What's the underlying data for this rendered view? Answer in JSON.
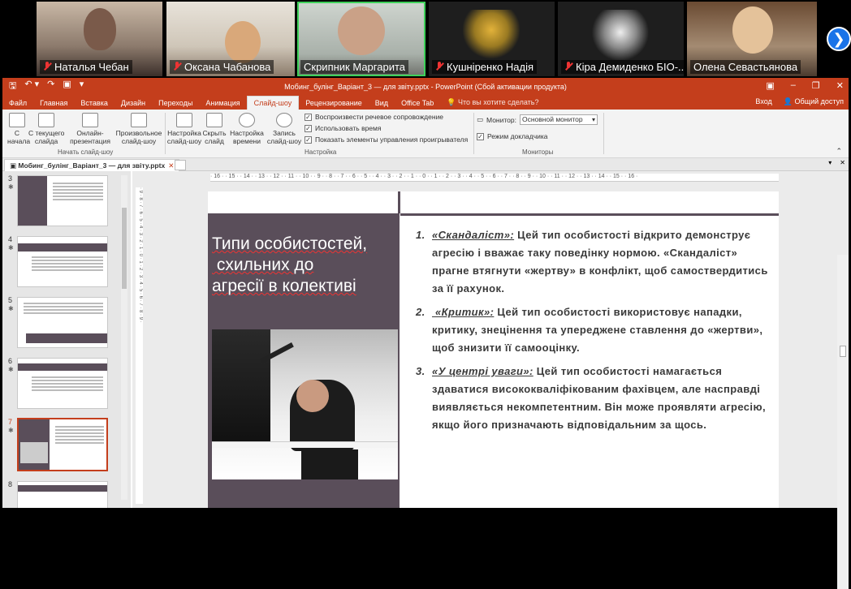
{
  "participants": [
    {
      "name": "Наталья Чебан",
      "muted": true
    },
    {
      "name": "Оксана Чабанова",
      "muted": true
    },
    {
      "name": "Скрипник Маргарита",
      "muted": false,
      "active": true
    },
    {
      "name": "Кушніренко Надія",
      "muted": true
    },
    {
      "name": "Кіра Демиденко БІО-...",
      "muted": true
    },
    {
      "name": "Олена Севастьянова",
      "muted": false
    }
  ],
  "window": {
    "title": "Мобинг_булінг_Варіант_3 — для звіту.pptx - PowerPoint (Сбой активации продукта)"
  },
  "tabs": [
    "Файл",
    "Главная",
    "Вставка",
    "Дизайн",
    "Переходы",
    "Анимация",
    "Слайд-шоу",
    "Рецензирование",
    "Вид",
    "Office Tab"
  ],
  "selected_tab": "Слайд-шоу",
  "tell_me": "Что вы хотите сделать?",
  "signin": "Вход",
  "share": "Общий доступ",
  "ribbon": {
    "from_start": "С\nначала",
    "from_current": "С текущего\nслайда",
    "online": "Онлайн-\nпрезентация",
    "custom": "Произвольное\nслайд-шоу",
    "group1": "Начать слайд-шоу",
    "setup": "Настройка\nслайд-шоу",
    "hide": "Скрыть\nслайд",
    "timing": "Настройка\nвремени",
    "record": "Запись\nслайд-шоу",
    "cb1": "Воспроизвести речевое сопровождение",
    "cb2": "Использовать время",
    "cb3": "Показать элементы управления проигрывателя",
    "group2": "Настройка",
    "monitor_label": "Монитор:",
    "monitor_value": "Основной монитор",
    "presenter": "Режим докладчика",
    "group3": "Мониторы"
  },
  "doc_tab": "Мобинг_булінг_Варіант_3 — для звіту.pptx",
  "thumb_numbers": [
    "3",
    "4",
    "5",
    "6",
    "7",
    "8"
  ],
  "slide": {
    "title_lines": [
      "Типи особистостей,",
      " схильних до",
      "агресії в колективі"
    ],
    "items": [
      {
        "num": "1.",
        "key": "«Скандаліст»:",
        "text": " Цей тип особистості відкрито демонструє агресію і вважає таку поведінку нормою. «Скандаліст» прагне втягнути «жертву» в конфлікт, щоб самоствердитись за її рахунок."
      },
      {
        "num": "2.",
        "key": " «Критик»:",
        "text": " Цей тип особистості використовує нападки, критику, знецінення та упереджене ставлення до «жертви», щоб знизити її самооцінку."
      },
      {
        "num": "3.",
        "key": "«У центрі уваги»:",
        "text": " Цей тип особистості намагається здаватися висококваліфікованим фахівцем, але насправді виявляється некомпетентним. Він може проявляти агресію, якщо його призначають відповідальним за щось."
      }
    ]
  },
  "ruler_text": "· 16 · · 15 · · 14 · · 13 · · 12 · · 11 · · 10 · · 9 · · 8 · · 7 · · 6 · · 5 · · 4 · · 3 · · 2 · · 1 · · 0 · · 1 · · 2 · · 3 · · 4 · · 5 · · 6 · · 7 · · 8 · · 9 · · 10 · · 11 · · 12 · · 13 · · 14 · · 15 · · 16 ·",
  "vruler_text": "· 9 · 8 · 7 · 6 · 5 · 4 · 3 · 2 · 1 · 0 · 1 · 2 · 3 · 4 · 5 · 6 · 7 · 8 · 9 ·"
}
